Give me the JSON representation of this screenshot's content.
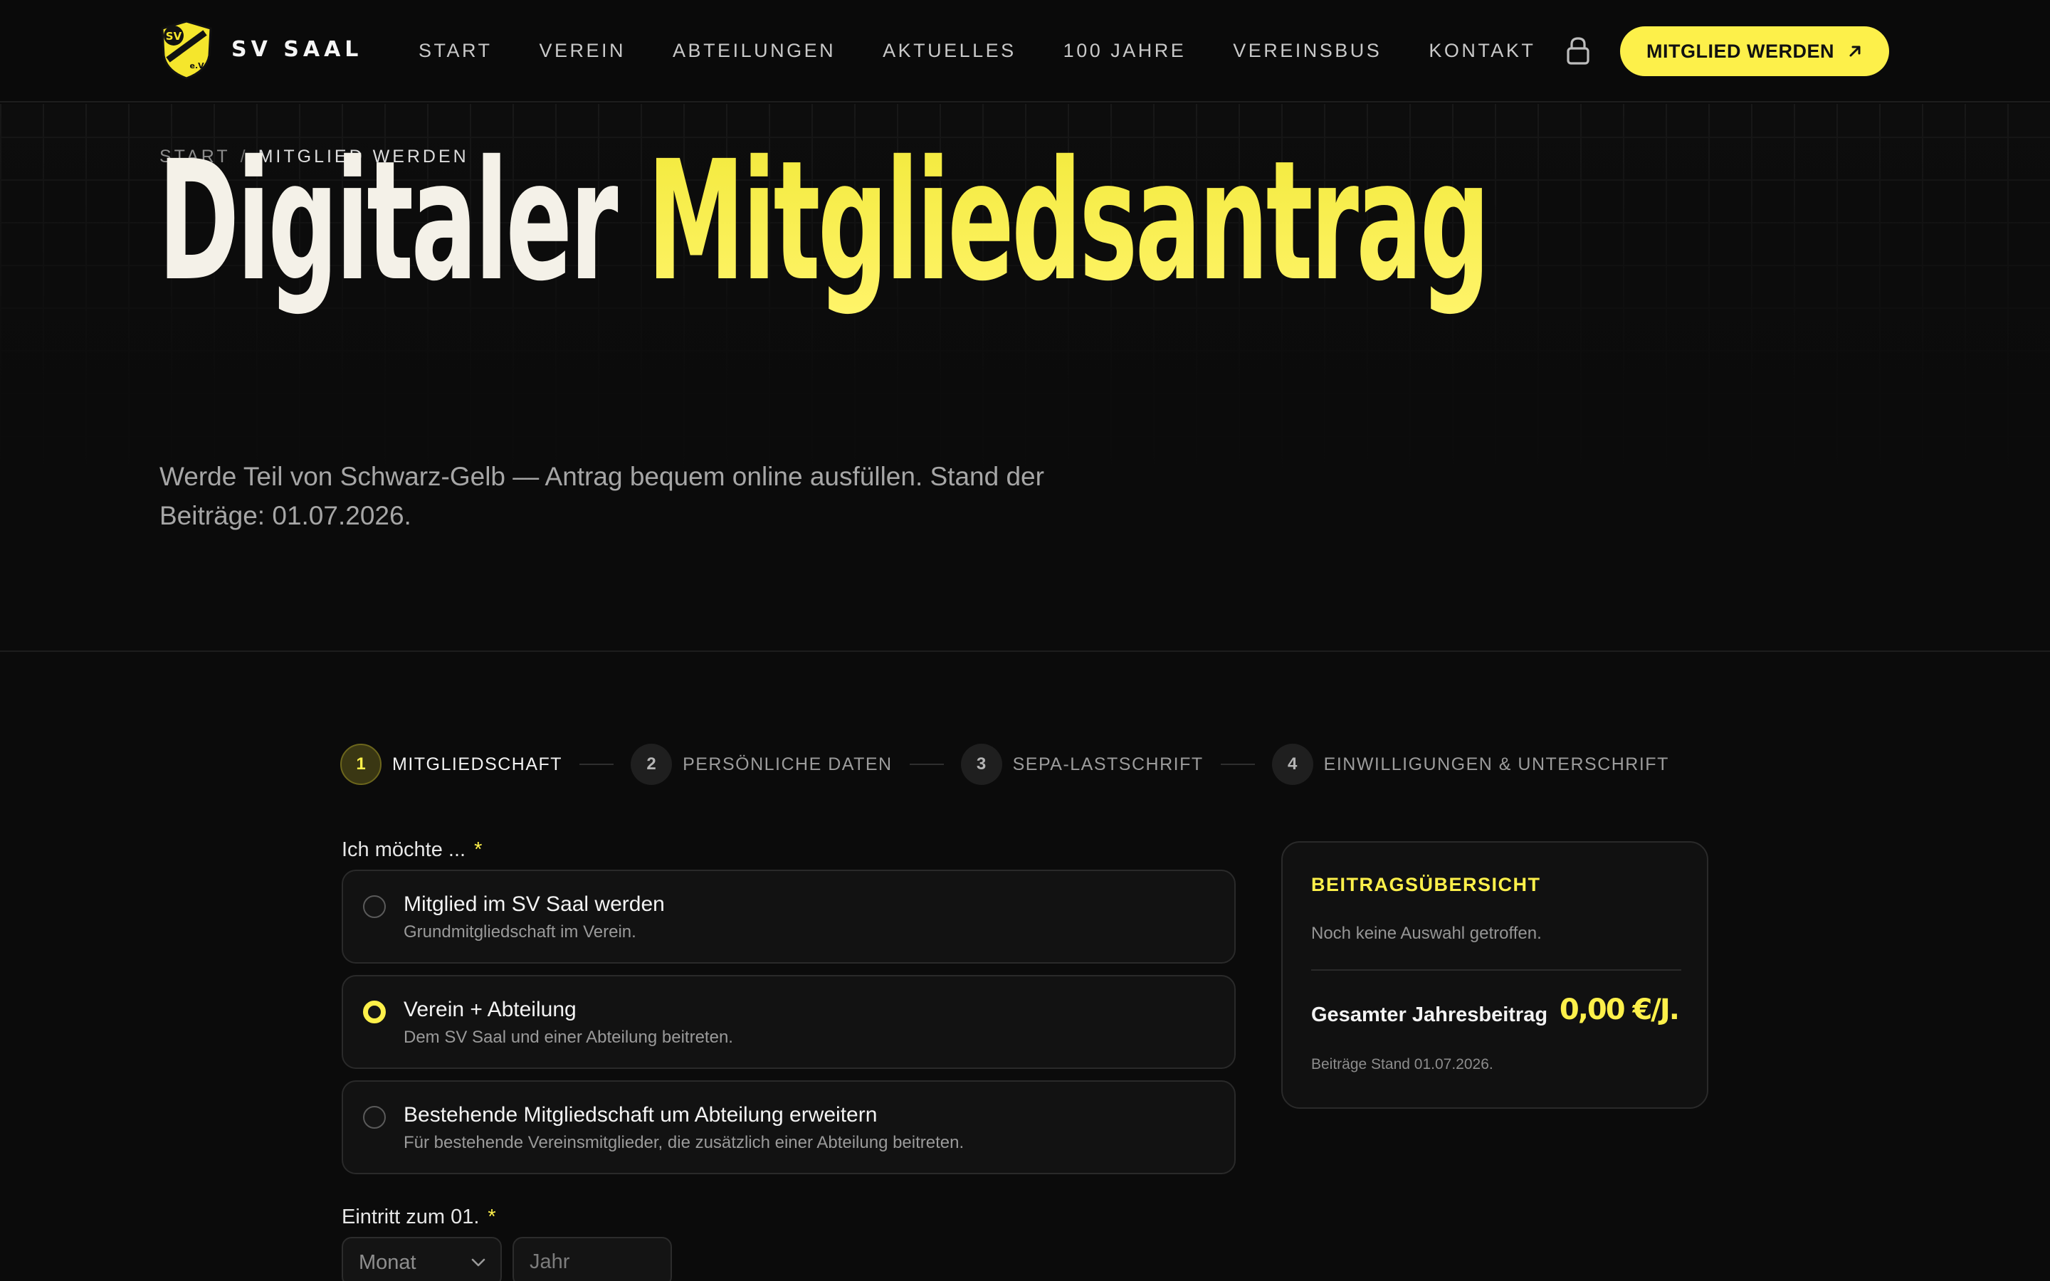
{
  "header": {
    "logo_icon": "club-crest-icon",
    "logo_text": "SV Saal / Donau e.V.",
    "brand": "SV SAAL",
    "nav": [
      "START",
      "VEREIN",
      "ABTEILUNGEN",
      "AKTUELLES",
      "100 JAHRE",
      "VEREINSBUS",
      "KONTAKT"
    ],
    "lock_icon": "lock-icon",
    "cta_label": "MITGLIED WERDEN",
    "cta_icon": "arrow-up-right-icon"
  },
  "hero": {
    "breadcrumb": {
      "home": "START",
      "separator": "/",
      "current": "MITGLIED WERDEN"
    },
    "title_part1": "Digitaler",
    "title_part2": "Mitgliedsantrag",
    "subtitle": "Werde Teil von Schwarz-Gelb — Antrag bequem online ausfüllen. Stand der Beiträge: 01.07.2026."
  },
  "stepper": {
    "steps": [
      {
        "num": "1",
        "label": "MITGLIEDSCHAFT",
        "active": true
      },
      {
        "num": "2",
        "label": "PERSÖNLICHE DATEN",
        "active": false
      },
      {
        "num": "3",
        "label": "SEPA-LASTSCHRIFT",
        "active": false
      },
      {
        "num": "4",
        "label": "EINWILLIGUNGEN & UNTERSCHRIFT",
        "active": false
      }
    ]
  },
  "form": {
    "intent_label": "Ich möchte ...",
    "required_mark": "*",
    "options": [
      {
        "title": "Mitglied im SV Saal werden",
        "desc": "Grundmitgliedschaft im Verein.",
        "checked": false
      },
      {
        "title": "Verein + Abteilung",
        "desc": "Dem SV Saal und einer Abteilung beitreten.",
        "checked": true
      },
      {
        "title": "Bestehende Mitgliedschaft um Abteilung erweitern",
        "desc": "Für bestehende Vereinsmitglieder, die zusätzlich einer Abteilung beitreten.",
        "checked": false
      }
    ],
    "entry_label": "Eintritt zum 01.",
    "month_select": "Monat",
    "year_placeholder": "Jahr"
  },
  "summary": {
    "title": "BEITRAGSÜBERSICHT",
    "empty_text": "Noch keine Auswahl getroffen.",
    "total_label": "Gesamter Jahresbeitrag",
    "total_value": "0,00 €/J.",
    "note": "Beiträge Stand 01.07.2026."
  },
  "colors": {
    "accent": "#fdf04a",
    "background": "#0b0b0b",
    "card": "#111111"
  }
}
